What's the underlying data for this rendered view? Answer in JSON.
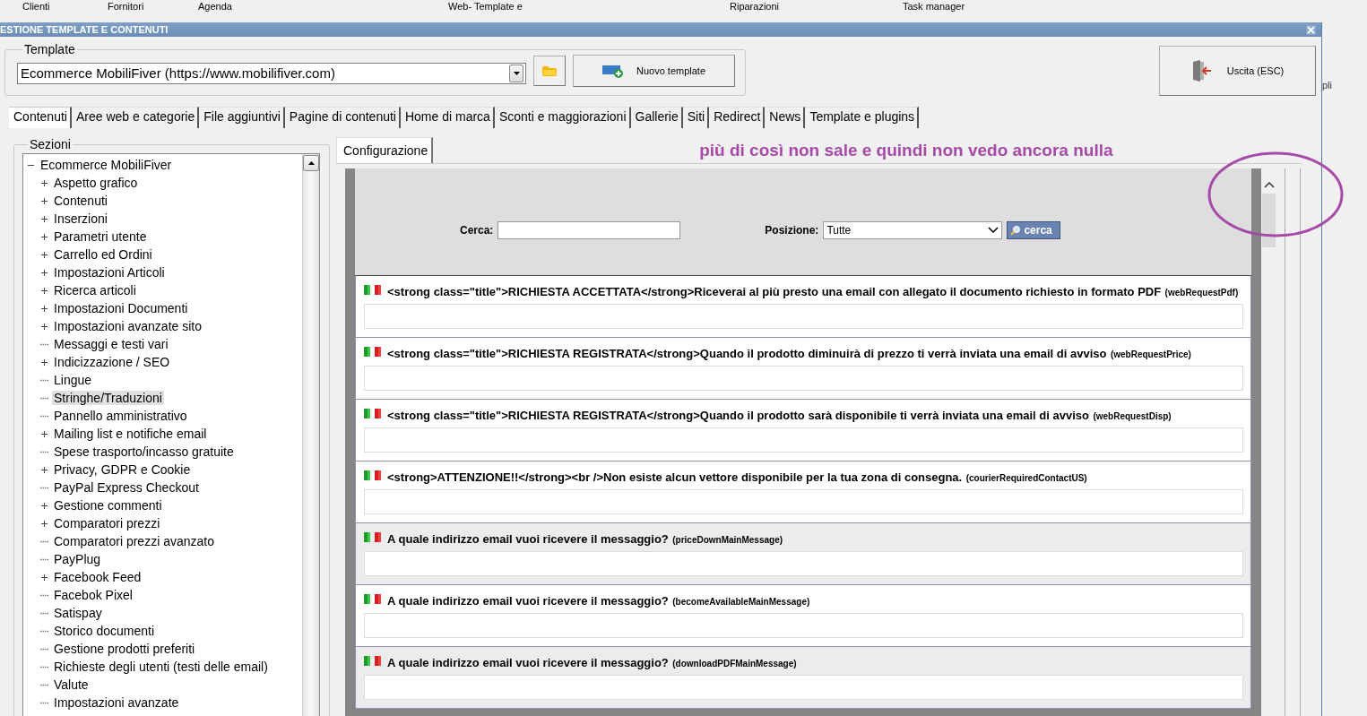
{
  "menu_bar": {
    "items": [
      "Clienti",
      "Fornitori",
      "Agenda",
      "Web- Template e",
      "Riparazioni",
      "Task manager"
    ]
  },
  "window": {
    "title": "ESTIONE TEMPLATE E CONTENUTI"
  },
  "outside_text": "pli",
  "template": {
    "legend": "Template",
    "value": "Ecommerce MobiliFiver (https://www.mobilifiver.com)",
    "new_button": "Nuovo template",
    "exit_button": "Uscita (ESC)"
  },
  "tabs": [
    {
      "label": "Contenuti",
      "selected": true
    },
    {
      "label": "Aree web e categorie",
      "selected": false
    },
    {
      "label": "File aggiuntivi",
      "selected": false
    },
    {
      "label": "Pagine di contenuti",
      "selected": false
    },
    {
      "label": "Home di marca",
      "selected": false
    },
    {
      "label": "Sconti e maggiorazioni",
      "selected": false
    },
    {
      "label": "Gallerie",
      "selected": false
    },
    {
      "label": "Siti",
      "selected": false
    },
    {
      "label": "Redirect",
      "selected": false
    },
    {
      "label": "News",
      "selected": false
    },
    {
      "label": "Template e plugins",
      "selected": false
    }
  ],
  "sections": {
    "legend": "Sezioni",
    "tree": [
      {
        "label": "Ecommerce MobiliFiver",
        "expanded": true,
        "selected": false,
        "children": [
          {
            "label": "Aspetto grafico",
            "expandable": true,
            "selected": false
          },
          {
            "label": "Contenuti",
            "expandable": true,
            "selected": false
          },
          {
            "label": "Inserzioni",
            "expandable": true,
            "selected": false
          },
          {
            "label": "Parametri utente",
            "expandable": true,
            "selected": false
          },
          {
            "label": "Carrello ed Ordini",
            "expandable": true,
            "selected": false
          },
          {
            "label": "Impostazioni Articoli",
            "expandable": true,
            "selected": false
          },
          {
            "label": "Ricerca articoli",
            "expandable": true,
            "selected": false
          },
          {
            "label": "Impostazioni Documenti",
            "expandable": true,
            "selected": false
          },
          {
            "label": "Impostazioni avanzate sito",
            "expandable": true,
            "selected": false
          },
          {
            "label": "Messaggi e testi vari",
            "expandable": false,
            "selected": false
          },
          {
            "label": "Indicizzazione / SEO",
            "expandable": true,
            "selected": false
          },
          {
            "label": "Lingue",
            "expandable": false,
            "selected": false
          },
          {
            "label": "Stringhe/Traduzioni",
            "expandable": false,
            "selected": true
          },
          {
            "label": "Pannello amministrativo",
            "expandable": false,
            "selected": false
          },
          {
            "label": "Mailing list e notifiche email",
            "expandable": true,
            "selected": false
          },
          {
            "label": "Spese trasporto/incasso gratuite",
            "expandable": false,
            "selected": false
          },
          {
            "label": "Privacy, GDPR e Cookie",
            "expandable": true,
            "selected": false
          },
          {
            "label": "PayPal Express Checkout",
            "expandable": false,
            "selected": false
          },
          {
            "label": "Gestione commenti",
            "expandable": true,
            "selected": false
          },
          {
            "label": "Comparatori prezzi",
            "expandable": true,
            "selected": false
          },
          {
            "label": "Comparatori prezzi avanzato",
            "expandable": false,
            "selected": false
          },
          {
            "label": "PayPlug",
            "expandable": false,
            "selected": false
          },
          {
            "label": "Facebook Feed",
            "expandable": true,
            "selected": false
          },
          {
            "label": "Facebok Pixel",
            "expandable": false,
            "selected": false
          },
          {
            "label": "Satispay",
            "expandable": false,
            "selected": false
          },
          {
            "label": "Storico documenti",
            "expandable": false,
            "selected": false
          },
          {
            "label": "Gestione prodotti preferiti",
            "expandable": false,
            "selected": false
          },
          {
            "label": "Richieste degli utenti (testi delle email)",
            "expandable": false,
            "selected": false
          },
          {
            "label": "Valute",
            "expandable": false,
            "selected": false
          },
          {
            "label": "Impostazioni avanzate",
            "expandable": false,
            "selected": false
          }
        ]
      }
    ]
  },
  "config_tab": {
    "label": "Configurazione",
    "selected": true
  },
  "annotation": "più di così non sale e quindi non vedo ancora nulla",
  "search": {
    "label": "Cerca:",
    "position_label": "Posizione:",
    "position_value": "Tutte",
    "button": "cerca"
  },
  "strings": [
    {
      "text": "<strong class=\"title\">RICHIESTA ACCETTATA</strong>Riceverai al più presto una email con allegato il documento richiesto in formato PDF",
      "key": "(webRequestPdf)",
      "highlighted": false
    },
    {
      "text": "<strong class=\"title\">RICHIESTA REGISTRATA</strong>Quando il prodotto diminuirà di prezzo ti verrà inviata una email di avviso",
      "key": "(webRequestPrice)",
      "highlighted": false
    },
    {
      "text": "<strong class=\"title\">RICHIESTA REGISTRATA</strong>Quando il prodotto sarà disponibile ti verrà inviata una email di avviso",
      "key": "(webRequestDisp)",
      "highlighted": false
    },
    {
      "text": "<strong>ATTENZIONE!!</strong><br />Non esiste alcun vettore disponibile per la tua zona di consegna.",
      "key": "(courierRequiredContactUS)",
      "highlighted": false
    },
    {
      "text": "A quale indirizzo email vuoi ricevere il messaggio?",
      "key": "(priceDownMainMessage)",
      "highlighted": true
    },
    {
      "text": "A quale indirizzo email vuoi ricevere il messaggio?",
      "key": "(becomeAvailableMainMessage)",
      "highlighted": false
    },
    {
      "text": "A quale indirizzo email vuoi ricevere il messaggio?",
      "key": "(downloadPDFMainMessage)",
      "highlighted": true
    }
  ]
}
